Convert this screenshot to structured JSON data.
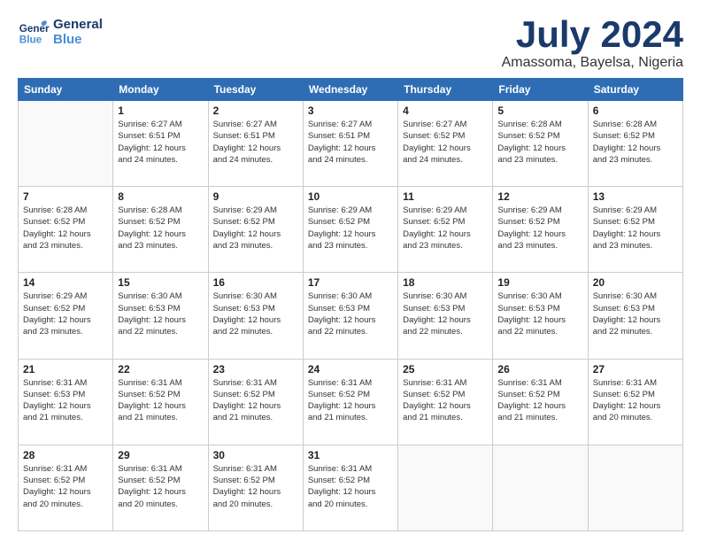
{
  "header": {
    "logo_general": "General",
    "logo_blue": "Blue",
    "month_title": "July 2024",
    "location": "Amassoma, Bayelsa, Nigeria"
  },
  "weekdays": [
    "Sunday",
    "Monday",
    "Tuesday",
    "Wednesday",
    "Thursday",
    "Friday",
    "Saturday"
  ],
  "weeks": [
    [
      {
        "day": "",
        "info": ""
      },
      {
        "day": "1",
        "info": "Sunrise: 6:27 AM\nSunset: 6:51 PM\nDaylight: 12 hours\nand 24 minutes."
      },
      {
        "day": "2",
        "info": "Sunrise: 6:27 AM\nSunset: 6:51 PM\nDaylight: 12 hours\nand 24 minutes."
      },
      {
        "day": "3",
        "info": "Sunrise: 6:27 AM\nSunset: 6:51 PM\nDaylight: 12 hours\nand 24 minutes."
      },
      {
        "day": "4",
        "info": "Sunrise: 6:27 AM\nSunset: 6:52 PM\nDaylight: 12 hours\nand 24 minutes."
      },
      {
        "day": "5",
        "info": "Sunrise: 6:28 AM\nSunset: 6:52 PM\nDaylight: 12 hours\nand 23 minutes."
      },
      {
        "day": "6",
        "info": "Sunrise: 6:28 AM\nSunset: 6:52 PM\nDaylight: 12 hours\nand 23 minutes."
      }
    ],
    [
      {
        "day": "7",
        "info": "Sunrise: 6:28 AM\nSunset: 6:52 PM\nDaylight: 12 hours\nand 23 minutes."
      },
      {
        "day": "8",
        "info": "Sunrise: 6:28 AM\nSunset: 6:52 PM\nDaylight: 12 hours\nand 23 minutes."
      },
      {
        "day": "9",
        "info": "Sunrise: 6:29 AM\nSunset: 6:52 PM\nDaylight: 12 hours\nand 23 minutes."
      },
      {
        "day": "10",
        "info": "Sunrise: 6:29 AM\nSunset: 6:52 PM\nDaylight: 12 hours\nand 23 minutes."
      },
      {
        "day": "11",
        "info": "Sunrise: 6:29 AM\nSunset: 6:52 PM\nDaylight: 12 hours\nand 23 minutes."
      },
      {
        "day": "12",
        "info": "Sunrise: 6:29 AM\nSunset: 6:52 PM\nDaylight: 12 hours\nand 23 minutes."
      },
      {
        "day": "13",
        "info": "Sunrise: 6:29 AM\nSunset: 6:52 PM\nDaylight: 12 hours\nand 23 minutes."
      }
    ],
    [
      {
        "day": "14",
        "info": "Sunrise: 6:29 AM\nSunset: 6:52 PM\nDaylight: 12 hours\nand 23 minutes."
      },
      {
        "day": "15",
        "info": "Sunrise: 6:30 AM\nSunset: 6:53 PM\nDaylight: 12 hours\nand 22 minutes."
      },
      {
        "day": "16",
        "info": "Sunrise: 6:30 AM\nSunset: 6:53 PM\nDaylight: 12 hours\nand 22 minutes."
      },
      {
        "day": "17",
        "info": "Sunrise: 6:30 AM\nSunset: 6:53 PM\nDaylight: 12 hours\nand 22 minutes."
      },
      {
        "day": "18",
        "info": "Sunrise: 6:30 AM\nSunset: 6:53 PM\nDaylight: 12 hours\nand 22 minutes."
      },
      {
        "day": "19",
        "info": "Sunrise: 6:30 AM\nSunset: 6:53 PM\nDaylight: 12 hours\nand 22 minutes."
      },
      {
        "day": "20",
        "info": "Sunrise: 6:30 AM\nSunset: 6:53 PM\nDaylight: 12 hours\nand 22 minutes."
      }
    ],
    [
      {
        "day": "21",
        "info": "Sunrise: 6:31 AM\nSunset: 6:53 PM\nDaylight: 12 hours\nand 21 minutes."
      },
      {
        "day": "22",
        "info": "Sunrise: 6:31 AM\nSunset: 6:52 PM\nDaylight: 12 hours\nand 21 minutes."
      },
      {
        "day": "23",
        "info": "Sunrise: 6:31 AM\nSunset: 6:52 PM\nDaylight: 12 hours\nand 21 minutes."
      },
      {
        "day": "24",
        "info": "Sunrise: 6:31 AM\nSunset: 6:52 PM\nDaylight: 12 hours\nand 21 minutes."
      },
      {
        "day": "25",
        "info": "Sunrise: 6:31 AM\nSunset: 6:52 PM\nDaylight: 12 hours\nand 21 minutes."
      },
      {
        "day": "26",
        "info": "Sunrise: 6:31 AM\nSunset: 6:52 PM\nDaylight: 12 hours\nand 21 minutes."
      },
      {
        "day": "27",
        "info": "Sunrise: 6:31 AM\nSunset: 6:52 PM\nDaylight: 12 hours\nand 20 minutes."
      }
    ],
    [
      {
        "day": "28",
        "info": "Sunrise: 6:31 AM\nSunset: 6:52 PM\nDaylight: 12 hours\nand 20 minutes."
      },
      {
        "day": "29",
        "info": "Sunrise: 6:31 AM\nSunset: 6:52 PM\nDaylight: 12 hours\nand 20 minutes."
      },
      {
        "day": "30",
        "info": "Sunrise: 6:31 AM\nSunset: 6:52 PM\nDaylight: 12 hours\nand 20 minutes."
      },
      {
        "day": "31",
        "info": "Sunrise: 6:31 AM\nSunset: 6:52 PM\nDaylight: 12 hours\nand 20 minutes."
      },
      {
        "day": "",
        "info": ""
      },
      {
        "day": "",
        "info": ""
      },
      {
        "day": "",
        "info": ""
      }
    ]
  ]
}
